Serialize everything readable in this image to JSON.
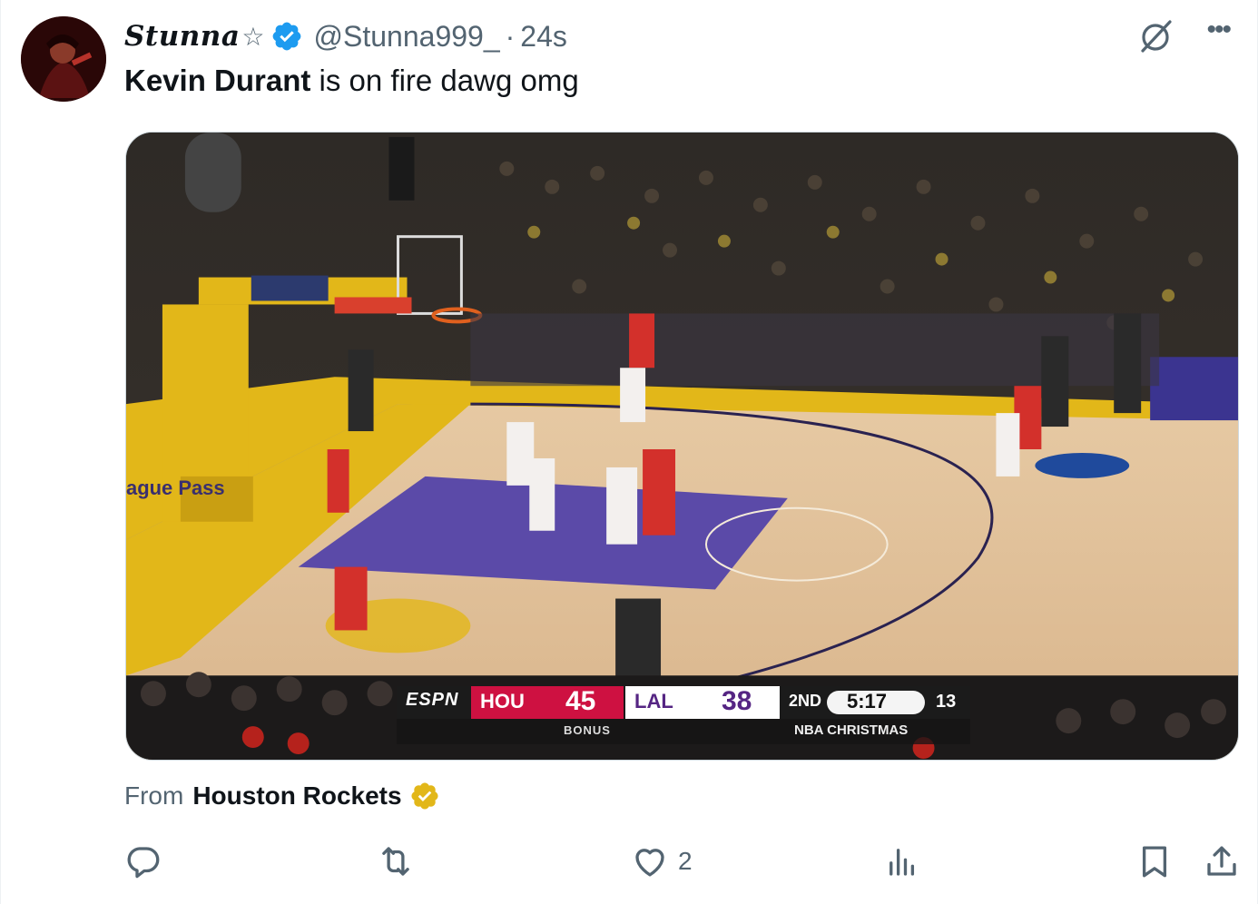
{
  "tweet": {
    "display_name": "Stunna",
    "name_symbol": "☆",
    "verified_icon": "verified-badge-icon",
    "handle": "@Stunna999_",
    "separator": "·",
    "time": "24s",
    "text_bold": "Kevin Durant",
    "text_rest": " is on fire dawg omg"
  },
  "media": {
    "type": "video-still",
    "scoreboard": {
      "network": "ESPN",
      "home_team": "HOU",
      "home_score": "45",
      "away_team": "LAL",
      "away_score": "38",
      "period": "2ND",
      "clock": "5:17",
      "shot_clock": "13",
      "bonus_label": "BONUS",
      "branding": "NBA CHRISTMAS"
    }
  },
  "source": {
    "from_label": "From",
    "name": "Houston Rockets",
    "badge_icon": "gold-verified-badge-icon"
  },
  "actions": {
    "reply_icon": "reply-icon",
    "retweet_icon": "retweet-icon",
    "like_icon": "heart-icon",
    "like_count": "2",
    "views_icon": "views-icon",
    "bookmark_icon": "bookmark-icon",
    "share_icon": "share-icon"
  },
  "colors": {
    "brand_blue": "#1d9bf0",
    "secondary_text": "#536471",
    "gold": "#e2b719",
    "rockets_red": "#ce1141",
    "lakers_purple": "#552583"
  }
}
